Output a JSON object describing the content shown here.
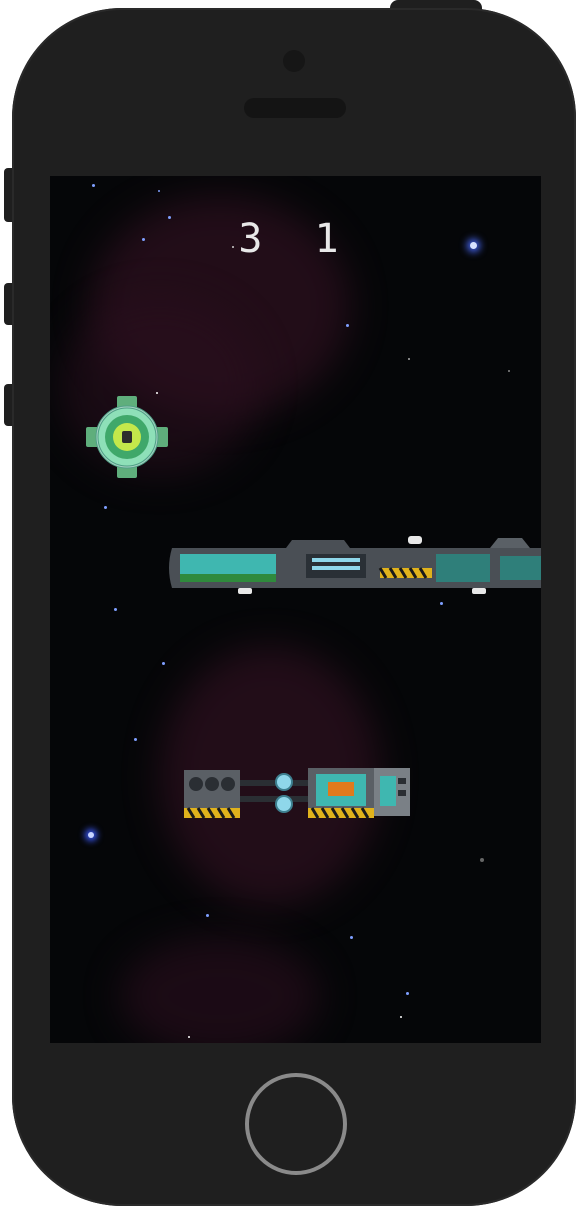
{
  "game": {
    "score": "3 1"
  },
  "colors": {
    "space": "#050608",
    "nebula": "#3a1326",
    "star": "#7f9fff",
    "hull": "#4a4f55",
    "glass": "#3fb7b0",
    "hazard": "#e0b21c",
    "player": "#6fd3a0"
  }
}
